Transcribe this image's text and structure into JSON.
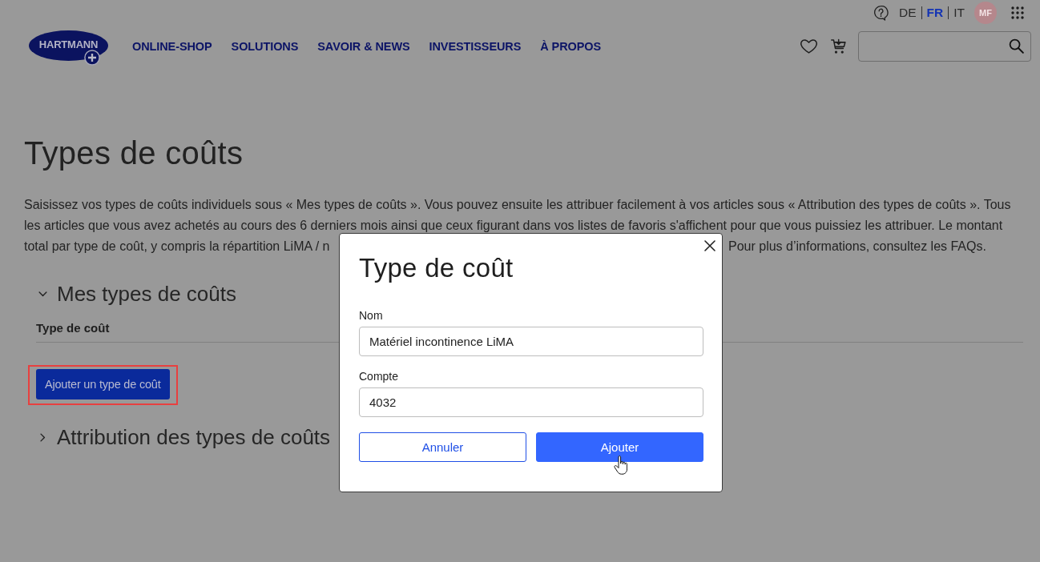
{
  "header": {
    "logo": "HARTMANN",
    "nav": [
      "ONLINE-SHOP",
      "SOLUTIONS",
      "SAVOIR & NEWS",
      "INVESTISSEURS",
      "À PROPOS"
    ],
    "languages": [
      {
        "label": "DE",
        "selected": false
      },
      {
        "label": "FR",
        "selected": true
      },
      {
        "label": "IT",
        "selected": false
      }
    ],
    "avatar": "MF"
  },
  "page": {
    "title": "Types de coûts",
    "intro": {
      "lines": [
        "Saisissez vos types de coûts individuels sous « Mes types de coûts ». Vous pouvez ensuite les attribuer facilement à vos articles sous « Attribution des types de coûts ». Tous",
        "les articles que vous avez achetés au cours des 6 derniers mois ainsi que ceux figurant dans vos listes de favoris s'affichent pour que vous puissiez les attribuer. Le montant",
        "total par type de coût, y compris la répartition LiMA / n"
      ],
      "visible_end": "Pour plus d’informations, consultez les FAQs."
    }
  },
  "sections": [
    {
      "title": "Mes types de coûts",
      "expanded": true,
      "column_header": "Type de coût",
      "add_button": {
        "label": "Ajouter un type de coût",
        "highlighted": true
      }
    },
    {
      "title": "Attribution des types de coûts",
      "expanded": false
    }
  ],
  "dialog": {
    "title": "Type de coût",
    "fields": [
      {
        "label": "Nom",
        "value": "Matériel incontinence LiMA"
      },
      {
        "label": "Compte",
        "value": "4032"
      }
    ],
    "buttons": [
      {
        "label": "Annuler",
        "kind": "outline",
        "hovered": false
      },
      {
        "label": "Ajouter",
        "kind": "filled",
        "hovered": true
      }
    ]
  }
}
